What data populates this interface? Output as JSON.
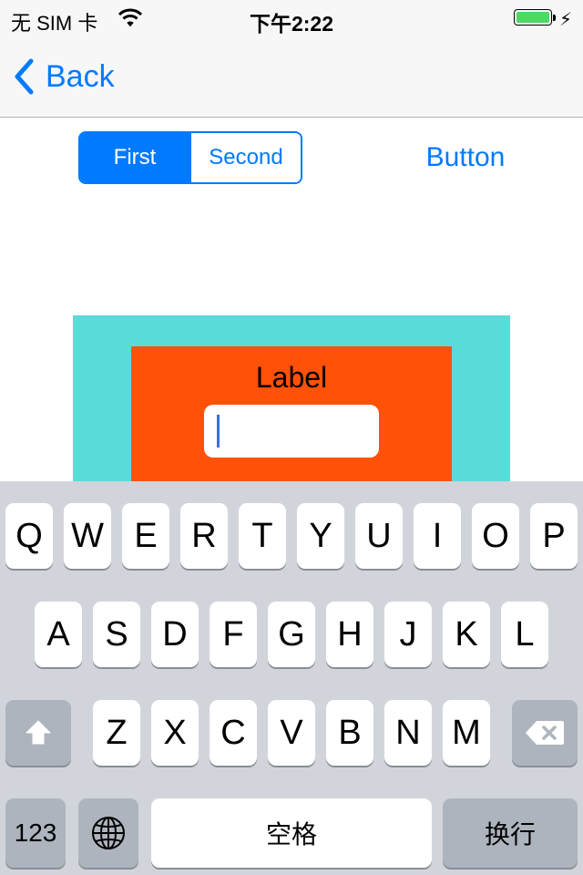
{
  "status_bar": {
    "carrier": "无 SIM 卡",
    "time": "下午2:22",
    "battery_level": 1.0,
    "battery_color": "#4cd964"
  },
  "nav": {
    "back_label": "Back",
    "accent_color": "#007aff"
  },
  "segmented_control": {
    "segments": [
      "First",
      "Second"
    ],
    "selected": "First"
  },
  "button": {
    "label": "Button"
  },
  "content": {
    "outer_color": "#5adbd8",
    "inner_color": "#ff5108",
    "label": "Label",
    "text_field": {
      "value": "",
      "placeholder": ""
    }
  },
  "keyboard": {
    "row1": [
      "Q",
      "W",
      "E",
      "R",
      "T",
      "Y",
      "U",
      "I",
      "O",
      "P"
    ],
    "row2": [
      "A",
      "S",
      "D",
      "F",
      "G",
      "H",
      "J",
      "K",
      "L"
    ],
    "row3": [
      "Z",
      "X",
      "C",
      "V",
      "B",
      "N",
      "M"
    ],
    "shift_icon": "shift-arrow-icon",
    "delete_icon": "delete-backspace-icon",
    "numbers_label": "123",
    "globe_icon": "globe-icon",
    "space_label": "空格",
    "return_label": "换行"
  }
}
